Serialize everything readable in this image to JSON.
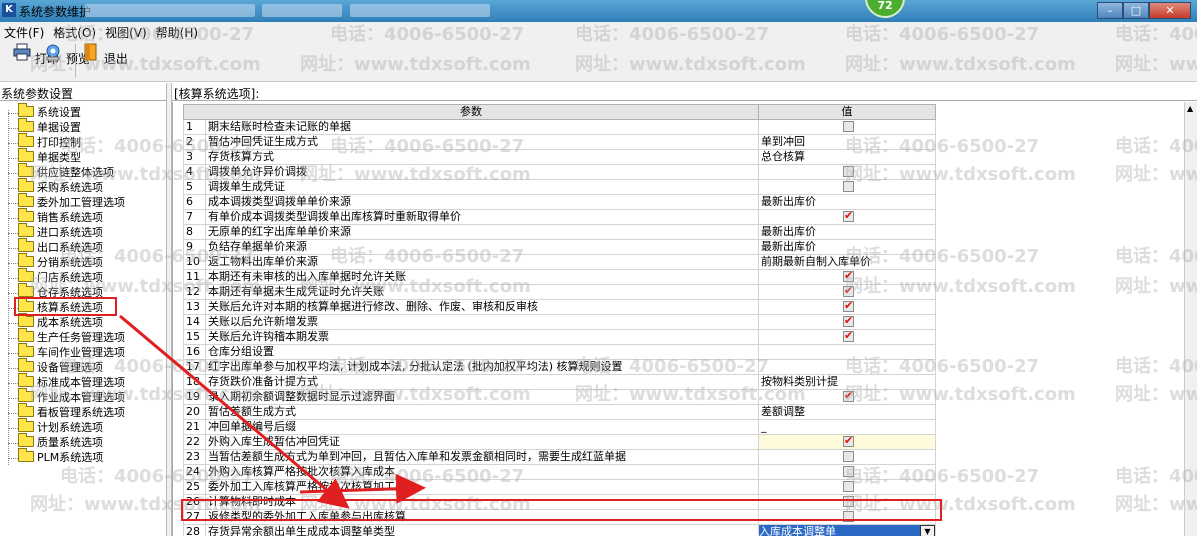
{
  "window": {
    "title": "系统参数维护",
    "app_icon": "app-logo-icon",
    "badge": "72",
    "controls": [
      "minimize-icon",
      "maximize-icon",
      "close-icon"
    ]
  },
  "menu": [
    "文件(F)",
    "格式(O)",
    "视图(V)",
    "帮助(H)"
  ],
  "toolbar": {
    "print": "打印",
    "preview": "预览",
    "exit": "退出"
  },
  "left_panel": {
    "header": "系统参数设置",
    "items": [
      "系统设置",
      "单据设置",
      "打印控制",
      "单据类型",
      "供应链整体选项",
      "采购系统选项",
      "委外加工管理选项",
      "销售系统选项",
      "进口系统选项",
      "出口系统选项",
      "分销系统选项",
      "门店系统选项",
      "仓存系统选项",
      "核算系统选项",
      "成本系统选项",
      "生产任务管理选项",
      "车间作业管理选项",
      "设备管理选项",
      "标准成本管理选项",
      "作业成本管理选项",
      "看板管理系统选项",
      "计划系统选项",
      "质量系统选项",
      "PLM系统选项"
    ],
    "selected_index": 13
  },
  "right_panel": {
    "header": "[核算系统选项]:",
    "columns": [
      "参数",
      "值"
    ],
    "rows": [
      {
        "n": "1",
        "p": "期末结账时检查未记账的单据",
        "t": "cb",
        "c": false
      },
      {
        "n": "2",
        "p": "暂估冲回凭证生成方式",
        "t": "text",
        "v": "单到冲回"
      },
      {
        "n": "3",
        "p": "存货核算方式",
        "t": "text",
        "v": "总仓核算"
      },
      {
        "n": "4",
        "p": "调拨单允许异价调拨",
        "t": "cb",
        "c": false
      },
      {
        "n": "5",
        "p": "调拨单生成凭证",
        "t": "cb",
        "c": false
      },
      {
        "n": "6",
        "p": "成本调拨类型调拨单单价来源",
        "t": "text",
        "v": "最新出库价"
      },
      {
        "n": "7",
        "p": "有单价成本调拨类型调拨单出库核算时重新取得单价",
        "t": "cb",
        "c": true
      },
      {
        "n": "8",
        "p": "无原单的红字出库单单价来源",
        "t": "text",
        "v": "最新出库价"
      },
      {
        "n": "9",
        "p": "负结存单据单价来源",
        "t": "text",
        "v": "最新出库价"
      },
      {
        "n": "10",
        "p": "返工物料出库单价来源",
        "t": "text",
        "v": "前期最新自制入库单价"
      },
      {
        "n": "11",
        "p": "本期还有未审核的出入库单据时允许关账",
        "t": "cb",
        "c": true
      },
      {
        "n": "12",
        "p": "本期还有单据未生成凭证时允许关账",
        "t": "cb",
        "c": true
      },
      {
        "n": "13",
        "p": "关账后允许对本期的核算单据进行修改、删除、作废、审核和反审核",
        "t": "cb",
        "c": true
      },
      {
        "n": "14",
        "p": "关账以后允许新增发票",
        "t": "cb",
        "c": true
      },
      {
        "n": "15",
        "p": "关账后允许钩稽本期发票",
        "t": "cb",
        "c": true
      },
      {
        "n": "16",
        "p": "仓库分组设置",
        "t": "text",
        "v": ""
      },
      {
        "n": "17",
        "p": "红字出库单参与加权平均法, 计划成本法, 分批认定法 (批内加权平均法) 核算规则设置",
        "t": "text",
        "v": ""
      },
      {
        "n": "18",
        "p": "存货跌价准备计提方式",
        "t": "text",
        "v": "按物料类别计提"
      },
      {
        "n": "19",
        "p": "录入期初余额调整数据时显示过滤界面",
        "t": "cb",
        "c": true
      },
      {
        "n": "20",
        "p": "暂估差额生成方式",
        "t": "text",
        "v": "差额调整"
      },
      {
        "n": "21",
        "p": "冲回单据编号后缀",
        "t": "text",
        "v": "_"
      },
      {
        "n": "22",
        "p": "外购入库生成暂估冲回凭证",
        "t": "cb",
        "c": true,
        "yellow": true
      },
      {
        "n": "23",
        "p": "当暂估差额生成方式为单到冲回，且暂估入库单和发票金额相同时，需要生成红蓝单据",
        "t": "cb",
        "c": false
      },
      {
        "n": "24",
        "p": "外购入库核算严格按批次核算入库成本",
        "t": "cb",
        "c": false
      },
      {
        "n": "25",
        "p": "委外加工入库核算严格按批次核算加工费",
        "t": "cb",
        "c": false
      },
      {
        "n": "26",
        "p": "计算物料即时成本",
        "t": "cb",
        "c": false
      },
      {
        "n": "27",
        "p": "返修类型的委外加工入库单参与出库核算",
        "t": "cb",
        "c": false
      },
      {
        "n": "28",
        "p": "存货异常余额出单生成成本调整单类型",
        "t": "dropdown",
        "v": "入库成本调整单",
        "selected": true
      }
    ]
  },
  "watermark": {
    "phone": "电话：4006-6500-27",
    "site": "网址：www.tdxsoft.com"
  },
  "colors": {
    "titlebar": "#3d8cc4",
    "selection": "#2c69c7",
    "annotation": "#e02020",
    "checkmark": "#e01010"
  }
}
